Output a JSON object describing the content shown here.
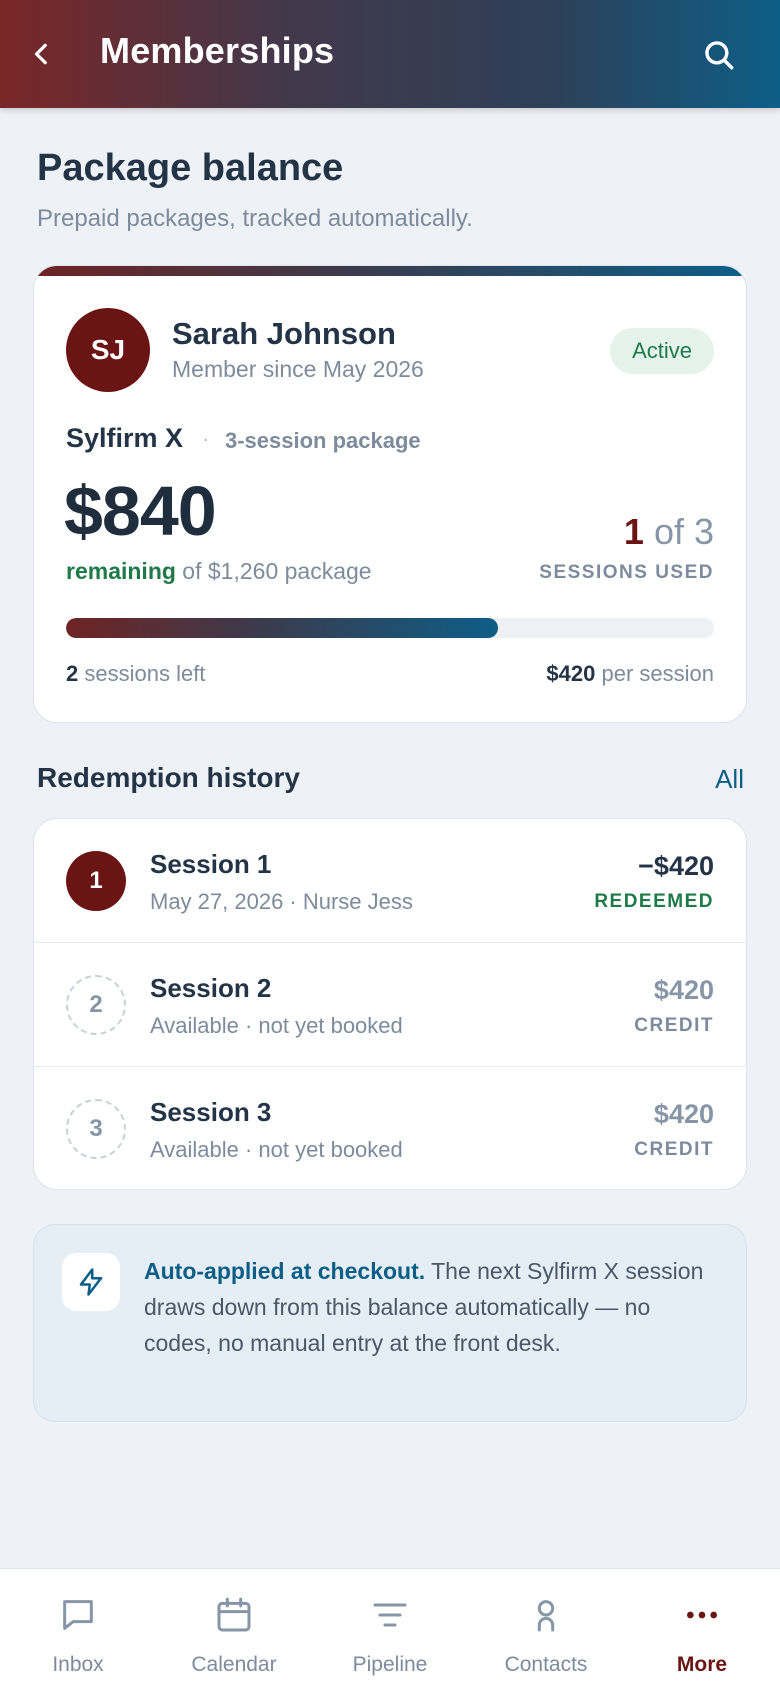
{
  "header": {
    "title": "Memberships"
  },
  "page": {
    "title": "Package balance",
    "subtitle": "Prepaid packages, tracked automatically."
  },
  "member": {
    "initials": "SJ",
    "name": "Sarah Johnson",
    "since": "Member since May 2026",
    "status": "Active"
  },
  "package": {
    "product": "Sylfirm X",
    "dot": "·",
    "type": "3-session package",
    "remaining_amount": "$840",
    "remaining_word": "remaining",
    "remaining_suffix": " of $1,260 package",
    "sessions_used": "1",
    "sessions_total": " of 3",
    "sessions_used_label": "SESSIONS USED",
    "progress_fraction": 0.667,
    "sessions_left_count": "2",
    "sessions_left_text": " sessions left",
    "per_session_amount": "$420",
    "per_session_text": " per session"
  },
  "history": {
    "title": "Redemption history",
    "link": "All",
    "rows": [
      {
        "num": "1",
        "title": "Session 1",
        "sub": "May 27, 2026 · Nurse Jess",
        "amount": "−$420",
        "status": "REDEEMED"
      },
      {
        "num": "2",
        "title": "Session 2",
        "sub": "Available · not yet booked",
        "amount": "$420",
        "status": "CREDIT"
      },
      {
        "num": "3",
        "title": "Session 3",
        "sub": "Available · not yet booked",
        "amount": "$420",
        "status": "CREDIT"
      }
    ]
  },
  "info": {
    "icon": "lightning-icon",
    "strong": "Auto-applied at checkout.",
    "text": " The next Sylfirm X session draws down from this balance automatically — no codes, no manual entry at the front desk."
  },
  "nav": {
    "items": [
      {
        "label": "Inbox",
        "icon": "inbox-icon"
      },
      {
        "label": "Calendar",
        "icon": "calendar-icon"
      },
      {
        "label": "Pipeline",
        "icon": "pipeline-icon"
      },
      {
        "label": "Contacts",
        "icon": "contacts-icon"
      },
      {
        "label": "More",
        "icon": "more-icon"
      }
    ]
  },
  "colors": {
    "accent": "#6b1414",
    "brand_blue": "#0d5e87",
    "success": "#1f7a4a"
  }
}
